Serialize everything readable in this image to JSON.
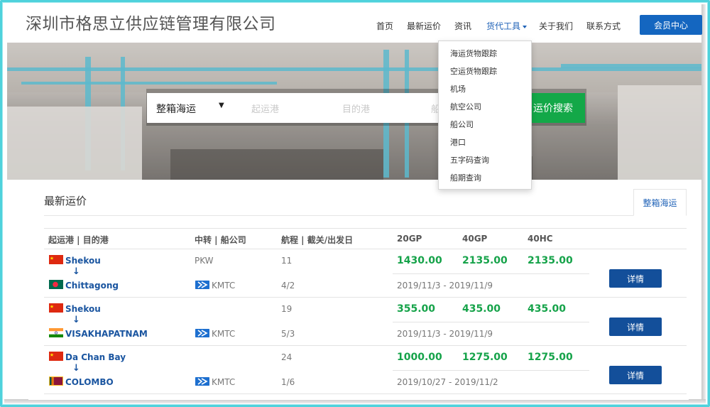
{
  "header": {
    "brand": "深圳市格思立供应链管理有限公司",
    "nav": [
      {
        "label": "首页"
      },
      {
        "label": "最新运价"
      },
      {
        "label": "资讯"
      },
      {
        "label": "货代工具"
      },
      {
        "label": "关于我们"
      },
      {
        "label": "联系方式"
      }
    ],
    "member_button": "会员中心"
  },
  "dropdown": {
    "items": [
      "海运货物跟踪",
      "空运货物跟踪",
      "机场",
      "航空公司",
      "船公司",
      "港口",
      "五字码查询",
      "船期查询"
    ]
  },
  "search": {
    "mode": "整箱海运",
    "origin_placeholder": "起运港",
    "destination_placeholder": "目的港",
    "carrier_placeholder_partial": "船",
    "button": "运价搜索"
  },
  "section": {
    "title": "最新运价",
    "tab": "整箱海运"
  },
  "table": {
    "headers": [
      "起运港 | 目的港",
      "中转 | 船公司",
      "航程 | 截关/出发日",
      "20GP",
      "40GP",
      "40HC"
    ],
    "rows": [
      {
        "origin": "Shekou",
        "origin_flag": "china",
        "destination": "Chittagong",
        "destination_flag": "bangladesh",
        "transit": "PKW",
        "carrier": "KMTC",
        "voyage_days": "11",
        "cutoff": "4/2",
        "p20gp": "1430.00",
        "p40gp": "2135.00",
        "p40hc": "2135.00",
        "validity": "2019/11/3 - 2019/11/9",
        "detail": "详情"
      },
      {
        "origin": "Shekou",
        "origin_flag": "china",
        "destination": "VISAKHAPATNAM",
        "destination_flag": "india",
        "transit": "",
        "carrier": "KMTC",
        "voyage_days": "19",
        "cutoff": "5/3",
        "p20gp": "355.00",
        "p40gp": "435.00",
        "p40hc": "435.00",
        "validity": "2019/11/3 - 2019/11/9",
        "detail": "详情"
      },
      {
        "origin": "Da Chan Bay",
        "origin_flag": "china",
        "destination": "COLOMBO",
        "destination_flag": "sri-lanka",
        "transit": "",
        "carrier": "KMTC",
        "voyage_days": "24",
        "cutoff": "1/6",
        "p20gp": "1000.00",
        "p40gp": "1275.00",
        "p40hc": "1275.00",
        "validity": "2019/10/27 - 2019/11/2",
        "detail": "详情"
      }
    ]
  },
  "colors": {
    "accent_blue": "#1466c0",
    "price_green": "#16a34a",
    "search_green": "#13a848",
    "frame_cyan": "#4fd2dc"
  }
}
